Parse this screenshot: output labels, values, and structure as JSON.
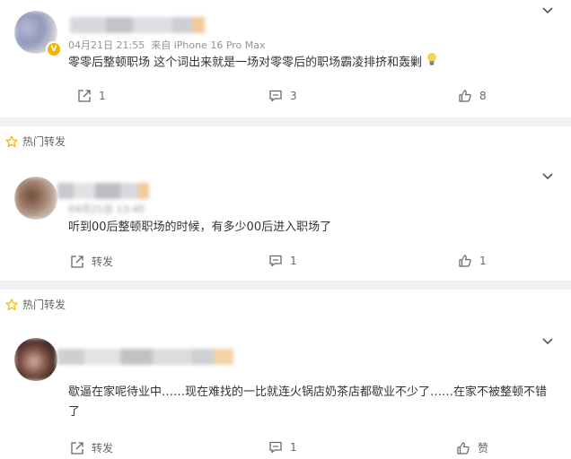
{
  "posts": [
    {
      "meta_date": "04月21日 21:55",
      "meta_source": "来自 iPhone 16 Pro Max",
      "text": "零零后整顿职场 这个词出来就是一场对零零后的职场霸凌排挤和轰剿",
      "share_count": "1",
      "comment_count": "3",
      "like_count": "8",
      "verified_badge": "V"
    },
    {
      "hot_label": "热门转发",
      "meta_date": "04月21日 13:45",
      "text": "听到00后整顿职场的时候，有多少00后进入职场了",
      "share_label": "转发",
      "comment_count": "1",
      "like_count": "1"
    },
    {
      "hot_label": "热门转发",
      "text": "歇逼在家呢待业中……现在难找的一比就连火锅店奶茶店都歇业不少了……在家不被整顿不错了",
      "share_label": "转发",
      "comment_count": "1",
      "like_label": "赞"
    }
  ],
  "colors": {
    "card_bg": "#ffffff",
    "page_bg": "#eef0f2",
    "badge": "#f5b400",
    "hot_star": "#f5b400",
    "text": "#333333",
    "muted": "#939393",
    "icon": "#666666"
  },
  "icons": [
    "chevron-down-icon",
    "star-icon",
    "share-icon",
    "comment-icon",
    "like-icon",
    "lightbulb-emoji"
  ]
}
